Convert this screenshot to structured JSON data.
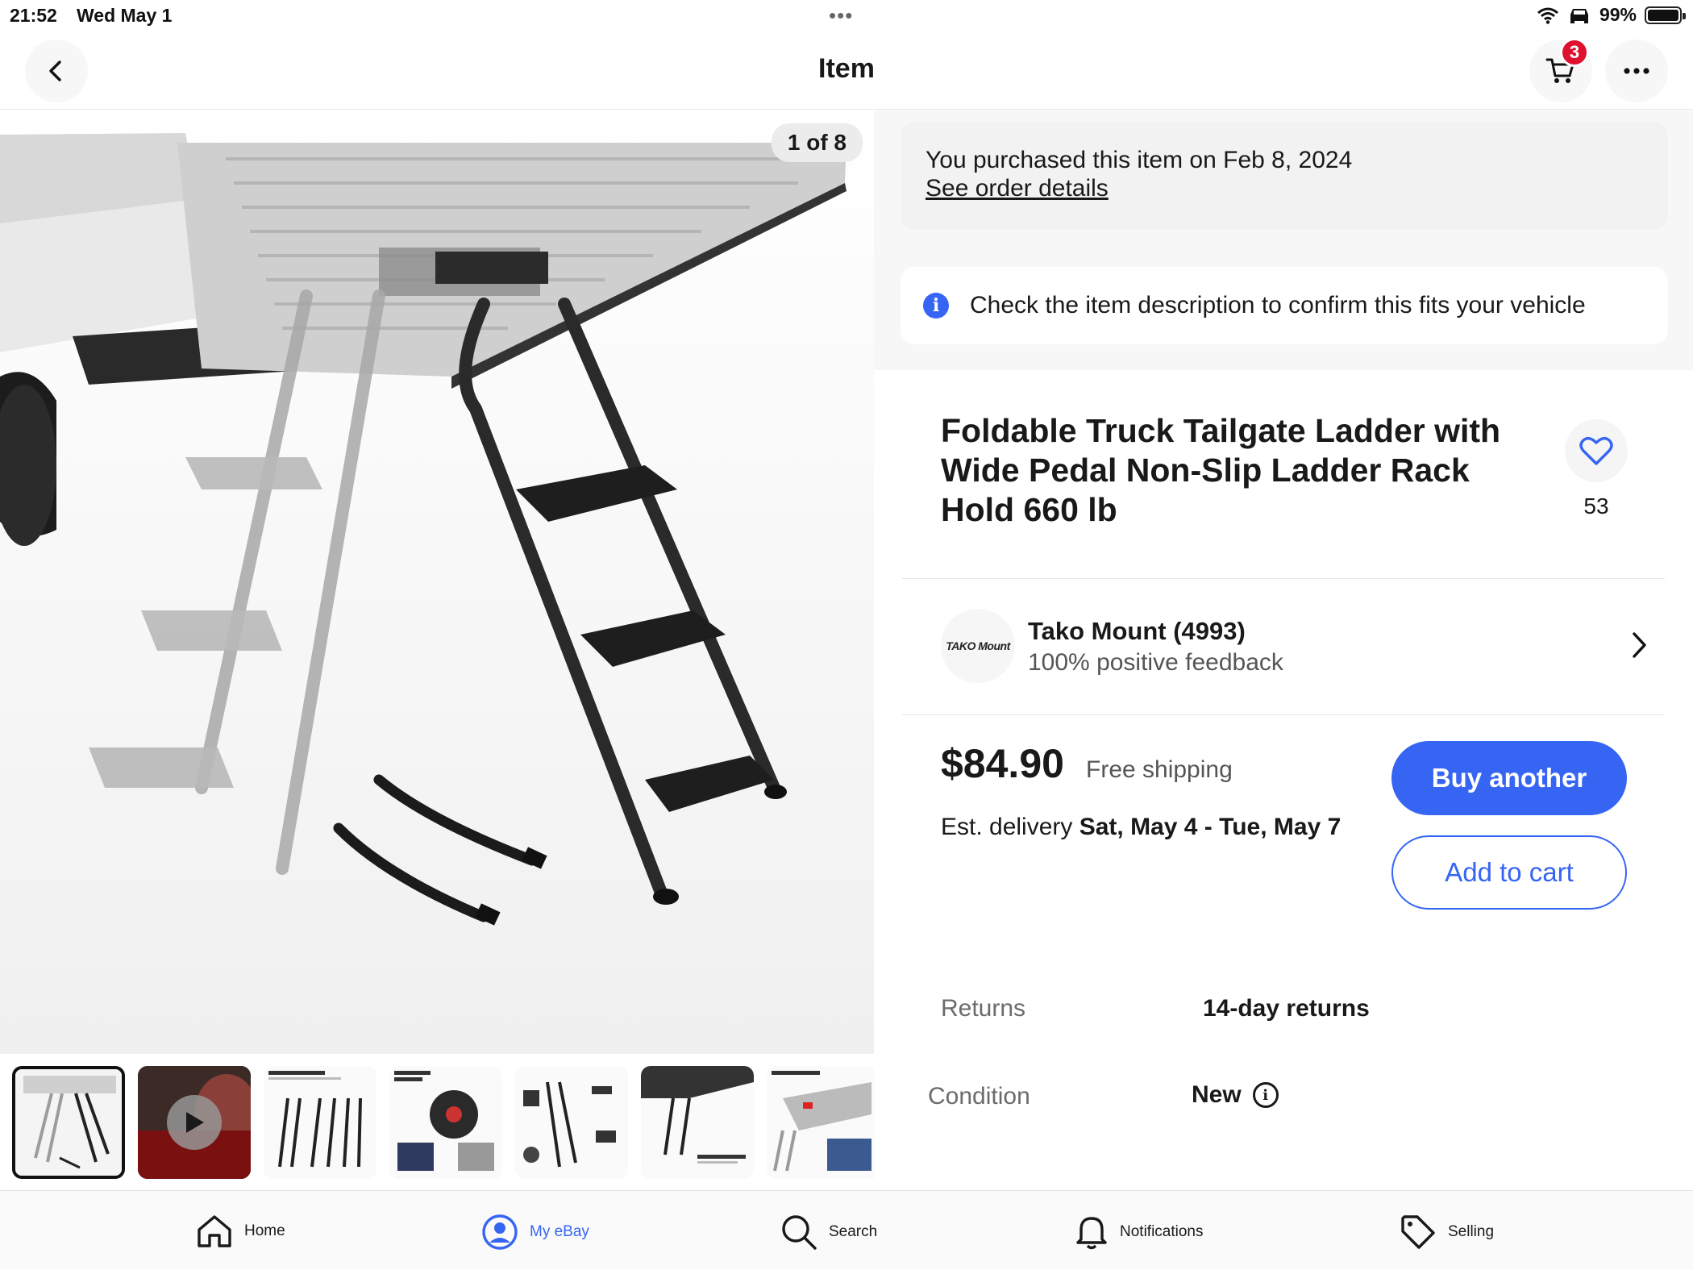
{
  "status_bar": {
    "time": "21:52",
    "date": "Wed May 1",
    "multitask_dots": "•••",
    "battery": "99%"
  },
  "header": {
    "title": "Item",
    "cart_count": "3"
  },
  "gallery": {
    "counter": "1 of 8",
    "thumbnails": [
      {
        "name": "ladder-main",
        "selected": true
      },
      {
        "name": "video",
        "selected": false
      },
      {
        "name": "height-adjustable",
        "selected": false
      },
      {
        "name": "rotatable-design",
        "selected": false
      },
      {
        "name": "parts-overview",
        "selected": false
      },
      {
        "name": "can-be-scalable",
        "selected": false
      },
      {
        "name": "foldable-design",
        "selected": false
      }
    ]
  },
  "purchase_notice": {
    "text": "You purchased this item on Feb 8, 2024",
    "link": "See order details"
  },
  "fit_notice": {
    "icon": "info-icon",
    "text": "Check the item description to confirm this fits your vehicle"
  },
  "item": {
    "title": "Foldable Truck Tailgate Ladder with Wide Pedal Non-Slip Ladder Rack Hold 660 lb",
    "watch_count": "53"
  },
  "seller": {
    "logo_text": "TAKO Mount",
    "name": "Tako Mount (4993)",
    "feedback": "100% positive feedback"
  },
  "pricing": {
    "price": "$84.90",
    "shipping": "Free shipping",
    "delivery_prefix": "Est. delivery ",
    "delivery_dates": "Sat, May 4 - Tue, May 7"
  },
  "actions": {
    "buy_label": "Buy another",
    "cart_label": "Add to cart"
  },
  "specs": {
    "returns_label": "Returns",
    "returns_value": "14-day returns",
    "condition_label": "Condition",
    "condition_value": "New"
  },
  "nav": {
    "items": [
      {
        "label": "Home",
        "icon": "home-icon"
      },
      {
        "label": "My eBay",
        "icon": "user-circle-icon",
        "active": true
      },
      {
        "label": "Search",
        "icon": "search-icon"
      },
      {
        "label": "Notifications",
        "icon": "bell-icon"
      },
      {
        "label": "Selling",
        "icon": "tag-icon"
      }
    ]
  },
  "colors": {
    "accent": "#3665f3",
    "badge": "#e0102f",
    "text": "#191919",
    "muted": "#6b6b6b"
  }
}
